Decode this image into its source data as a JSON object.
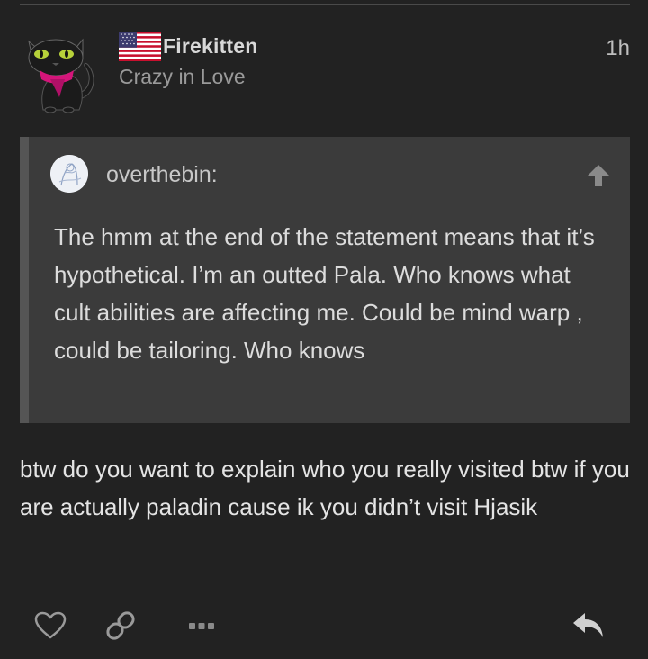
{
  "post": {
    "username": "Firekitten",
    "user_title": "Crazy in Love",
    "timestamp": "1h",
    "body": "btw do you want to explain who you really visited btw if you are actually paladin cause ik you didn’t visit Hjasik"
  },
  "quote": {
    "author": "overthebin:",
    "text": "The hmm at the end of the statement means that it’s hypothetical. I’m an outted Pala. Who knows what cult abilities are affecting me. Could be mind warp , could be tailoring. Who knows"
  },
  "icons": {
    "flag": "us-flag-icon",
    "like": "heart-icon",
    "link": "link-icon",
    "more": "ellipsis-icon",
    "reply": "reply-icon",
    "quote_jump": "arrow-up-icon"
  },
  "colors": {
    "background": "#222222",
    "quote_background": "#3b3b3b",
    "quote_border": "#555555",
    "accent_pink": "#d4157a"
  }
}
